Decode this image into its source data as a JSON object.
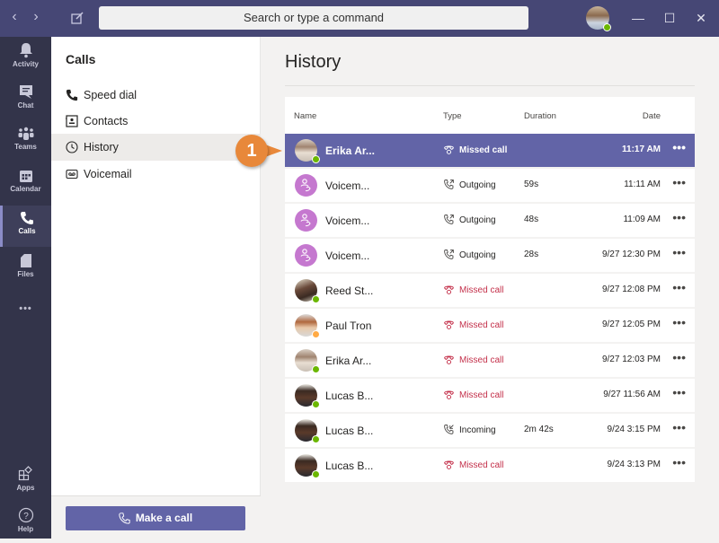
{
  "titlebar": {
    "search_placeholder": "Search or type a command",
    "back_label": "‹",
    "forward_label": "›",
    "minimize_label": "—",
    "maximize_label": "☐",
    "close_label": "✕",
    "user_status": "available"
  },
  "rail": {
    "items": [
      {
        "label": "Activity",
        "icon": "bell-icon"
      },
      {
        "label": "Chat",
        "icon": "chat-icon"
      },
      {
        "label": "Teams",
        "icon": "teams-icon"
      },
      {
        "label": "Calendar",
        "icon": "calendar-icon"
      },
      {
        "label": "Calls",
        "icon": "phone-icon",
        "active": true
      },
      {
        "label": "Files",
        "icon": "file-icon"
      }
    ],
    "more_label": "•••",
    "apps_label": "Apps",
    "help_label": "Help"
  },
  "panel": {
    "title": "Calls",
    "items": [
      {
        "label": "Speed dial",
        "icon": "phone-icon"
      },
      {
        "label": "Contacts",
        "icon": "contact-card-icon"
      },
      {
        "label": "History",
        "icon": "clock-icon",
        "selected": true
      },
      {
        "label": "Voicemail",
        "icon": "voicemail-icon"
      }
    ],
    "make_call_label": "Make a call"
  },
  "main": {
    "title": "History",
    "columns": {
      "name": "Name",
      "type": "Type",
      "duration": "Duration",
      "date": "Date"
    },
    "rows": [
      {
        "name": "Erika Ar...",
        "type": "Missed call",
        "kind": "missed",
        "duration": "",
        "date": "11:17 AM",
        "avatar": "erika",
        "presence": "available",
        "selected": true
      },
      {
        "name": "Voicem...",
        "type": "Outgoing",
        "kind": "outgoing",
        "duration": "59s",
        "date": "11:11 AM",
        "avatar": "voicemail"
      },
      {
        "name": "Voicem...",
        "type": "Outgoing",
        "kind": "outgoing",
        "duration": "48s",
        "date": "11:09 AM",
        "avatar": "voicemail"
      },
      {
        "name": "Voicem...",
        "type": "Outgoing",
        "kind": "outgoing",
        "duration": "28s",
        "date": "9/27 12:30 PM",
        "avatar": "voicemail"
      },
      {
        "name": "Reed St...",
        "type": "Missed call",
        "kind": "missed",
        "duration": "",
        "date": "9/27 12:08 PM",
        "avatar": "reed",
        "presence": "available"
      },
      {
        "name": "Paul Tron",
        "type": "Missed call",
        "kind": "missed",
        "duration": "",
        "date": "9/27 12:05 PM",
        "avatar": "paul",
        "presence": "away"
      },
      {
        "name": "Erika Ar...",
        "type": "Missed call",
        "kind": "missed",
        "duration": "",
        "date": "9/27 12:03 PM",
        "avatar": "erika",
        "presence": "available"
      },
      {
        "name": "Lucas B...",
        "type": "Missed call",
        "kind": "missed",
        "duration": "",
        "date": "9/27 11:56 AM",
        "avatar": "lucas",
        "presence": "available"
      },
      {
        "name": "Lucas B...",
        "type": "Incoming",
        "kind": "incoming",
        "duration": "2m 42s",
        "date": "9/24 3:15 PM",
        "avatar": "lucas",
        "presence": "available"
      },
      {
        "name": "Lucas B...",
        "type": "Missed call",
        "kind": "missed",
        "duration": "",
        "date": "9/24 3:13 PM",
        "avatar": "lucas",
        "presence": "available"
      }
    ],
    "more_label": "•••"
  },
  "callout": {
    "number": "1"
  },
  "colors": {
    "brand": "#6264a7",
    "titlebar": "#464775",
    "rail": "#33344a",
    "missed": "#c4314b",
    "voicemail_avatar": "#c578cf",
    "callout": "#e8883a",
    "available": "#6bb700",
    "away": "#ffaa44"
  }
}
